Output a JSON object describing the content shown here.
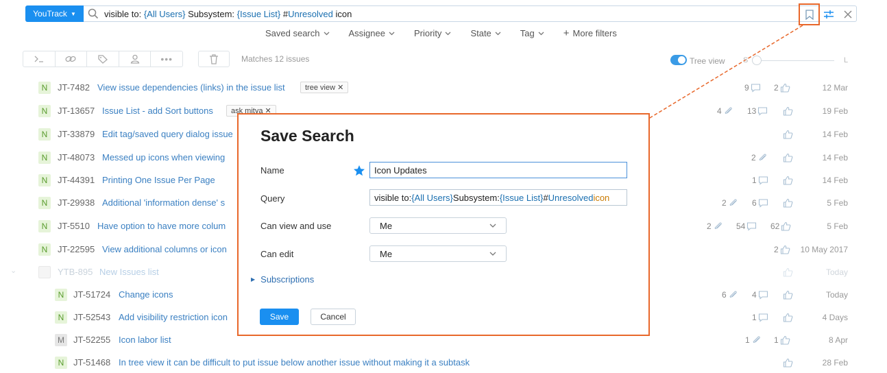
{
  "header": {
    "app_button": "YouTrack",
    "query": {
      "p1": "visible to: ",
      "p2": "{All Users}",
      "p3": " Subsystem: ",
      "p4": "{Issue List}",
      "p5": " #",
      "p6": "Unresolved",
      "p7": " icon"
    }
  },
  "filters": [
    "Saved search",
    "Assignee",
    "Priority",
    "State",
    "Tag",
    "More filters"
  ],
  "toolbar": {
    "matches": "Matches 12 issues",
    "tree_view": "Tree view",
    "size_small": "S",
    "size_large": "L"
  },
  "issues": [
    {
      "state": "N",
      "id": "JT-7482",
      "summary": "View issue dependencies (links) in the issue list",
      "tag": "tree view",
      "attachments": "",
      "comments": "9",
      "votes": "2",
      "date": "12 Mar"
    },
    {
      "state": "N",
      "id": "JT-13657",
      "summary": "Issue List - add Sort buttons",
      "tag": "ask mitya",
      "attachments": "4",
      "comments": "13",
      "votes": "",
      "date": "19 Feb"
    },
    {
      "state": "N",
      "id": "JT-33879",
      "summary": "Edit tag/saved query dialog issue",
      "tag": "",
      "attachments": "",
      "comments": "",
      "votes": "",
      "date": "14 Feb"
    },
    {
      "state": "N",
      "id": "JT-48073",
      "summary": "Messed up icons when viewing",
      "tag": "",
      "attachments": "2",
      "comments": "",
      "votes": "",
      "date": "14 Feb"
    },
    {
      "state": "N",
      "id": "JT-44391",
      "summary": "Printing One Issue Per Page",
      "tag": "",
      "attachments": "",
      "comments": "1",
      "votes": "",
      "date": "14 Feb"
    },
    {
      "state": "N",
      "id": "JT-29938",
      "summary": "Additional 'information dense' s",
      "tag": "",
      "attachments": "2",
      "comments": "6",
      "votes": "",
      "date": "5 Feb"
    },
    {
      "state": "N",
      "id": "JT-5510",
      "summary": "Have option to have more colum",
      "tag": "",
      "attachments": "2",
      "comments": "54",
      "votes": "62",
      "date": "5 Feb"
    },
    {
      "state": "N",
      "id": "JT-22595",
      "summary": "View additional columns or icon",
      "tag": "",
      "attachments": "",
      "comments": "",
      "votes": "2",
      "date": "10 May 2017"
    },
    {
      "state": "",
      "id": "YTB-895",
      "summary": "New Issues list",
      "tag": "",
      "attachments": "",
      "comments": "",
      "votes": "",
      "date": "Today"
    },
    {
      "state": "N",
      "id": "JT-51724",
      "summary": "Change icons",
      "tag": "",
      "attachments": "6",
      "comments": "4",
      "votes": "",
      "date": "Today"
    },
    {
      "state": "N",
      "id": "JT-52543",
      "summary": "Add visibility restriction icon",
      "tag": "",
      "attachments": "",
      "comments": "1",
      "votes": "",
      "date": "4 Days"
    },
    {
      "state": "M",
      "id": "JT-52255",
      "summary": "Icon labor list",
      "tag": "",
      "attachments": "",
      "comments": "1",
      "votes": "1",
      "date": "8 Apr"
    },
    {
      "state": "N",
      "id": "JT-51468",
      "summary": "In tree view it can be difficult to put issue below another issue without making it a subtask",
      "tag": "",
      "attachments": "",
      "comments": "",
      "votes": "",
      "date": "28 Feb"
    }
  ],
  "dialog": {
    "title": "Save Search",
    "name_label": "Name",
    "name_value": "Icon Updates",
    "query_label": "Query",
    "query": {
      "p1": "visible to: ",
      "p2": "{All Users}",
      "p3": " Subsystem: ",
      "p4": "{Issue List}",
      "p5": " #",
      "p6": "Unresolved",
      "p7": " icon"
    },
    "can_view_label": "Can view and use",
    "can_view_value": "Me",
    "can_edit_label": "Can edit",
    "can_edit_value": "Me",
    "subscriptions": "Subscriptions",
    "save": "Save",
    "cancel": "Cancel"
  },
  "colors": {
    "accent": "#1a8ff0",
    "highlight": "#e8672a",
    "new_state": "#5a9c2e"
  }
}
